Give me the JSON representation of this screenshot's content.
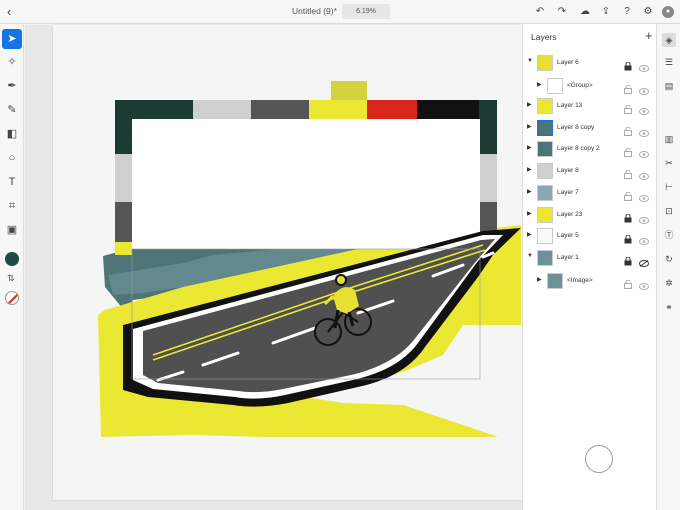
{
  "topbar": {
    "back_icon": "chevron-left-icon",
    "title": "Untitled (9)*",
    "zoom": "6.19%",
    "icons": [
      "undo-icon",
      "redo-icon",
      "cloud-sync-icon",
      "share-icon",
      "help-icon",
      "settings-icon",
      "user-icon"
    ]
  },
  "left_toolbar": {
    "tools": [
      "select-tool-icon",
      "direct-select-tool-icon",
      "pen-tool-icon",
      "pencil-tool-icon",
      "eraser-tool-icon",
      "shape-tool-icon",
      "type-tool-icon",
      "transform-tool-icon",
      "image-tool-icon"
    ],
    "fill_color": "#1f4b46",
    "stroke_color": "none"
  },
  "layers_panel": {
    "title": "Layers",
    "add_icon": "plus-icon",
    "layers": [
      {
        "name": "Layer 6",
        "expanded": true,
        "locked": true,
        "indent": 0
      },
      {
        "name": "<Group>",
        "expanded": false,
        "locked": false,
        "indent": 1
      },
      {
        "name": "Layer 13",
        "expanded": false,
        "locked": false,
        "indent": 0
      },
      {
        "name": "Layer 8 copy",
        "expanded": false,
        "locked": false,
        "indent": 0,
        "selected_thumb": true
      },
      {
        "name": "Layer 8 copy 2",
        "expanded": false,
        "locked": false,
        "indent": 0
      },
      {
        "name": "Layer 8",
        "expanded": false,
        "locked": false,
        "indent": 0
      },
      {
        "name": "Layer 7",
        "expanded": false,
        "locked": false,
        "indent": 0
      },
      {
        "name": "Layer 23",
        "expanded": false,
        "locked": true,
        "indent": 0
      },
      {
        "name": "Layer 5",
        "expanded": false,
        "locked": true,
        "indent": 0
      },
      {
        "name": "Layer 1",
        "expanded": true,
        "locked": true,
        "indent": 0,
        "hidden": true
      },
      {
        "name": "<Image>",
        "expanded": false,
        "locked": false,
        "indent": 1
      }
    ]
  },
  "right_toolbar": {
    "icons": [
      "layers-icon",
      "properties-icon",
      "libraries-icon",
      "arrange-icon",
      "scissors-icon",
      "align-icon",
      "transform-icon",
      "text-properties-icon",
      "repeat-icon",
      "settings-icon",
      "link-icon"
    ]
  },
  "artwork": {
    "colors": {
      "yellow": "#ebe834",
      "road": "#505050",
      "road_edge": "#111111",
      "frame_green": "#1b3b33",
      "frame_gray": "#cfcfcf",
      "frame_dark": "#555555",
      "frame_red": "#d9261c",
      "sea": "#4f7478",
      "cyclist_jersey": "#e8e030"
    }
  }
}
